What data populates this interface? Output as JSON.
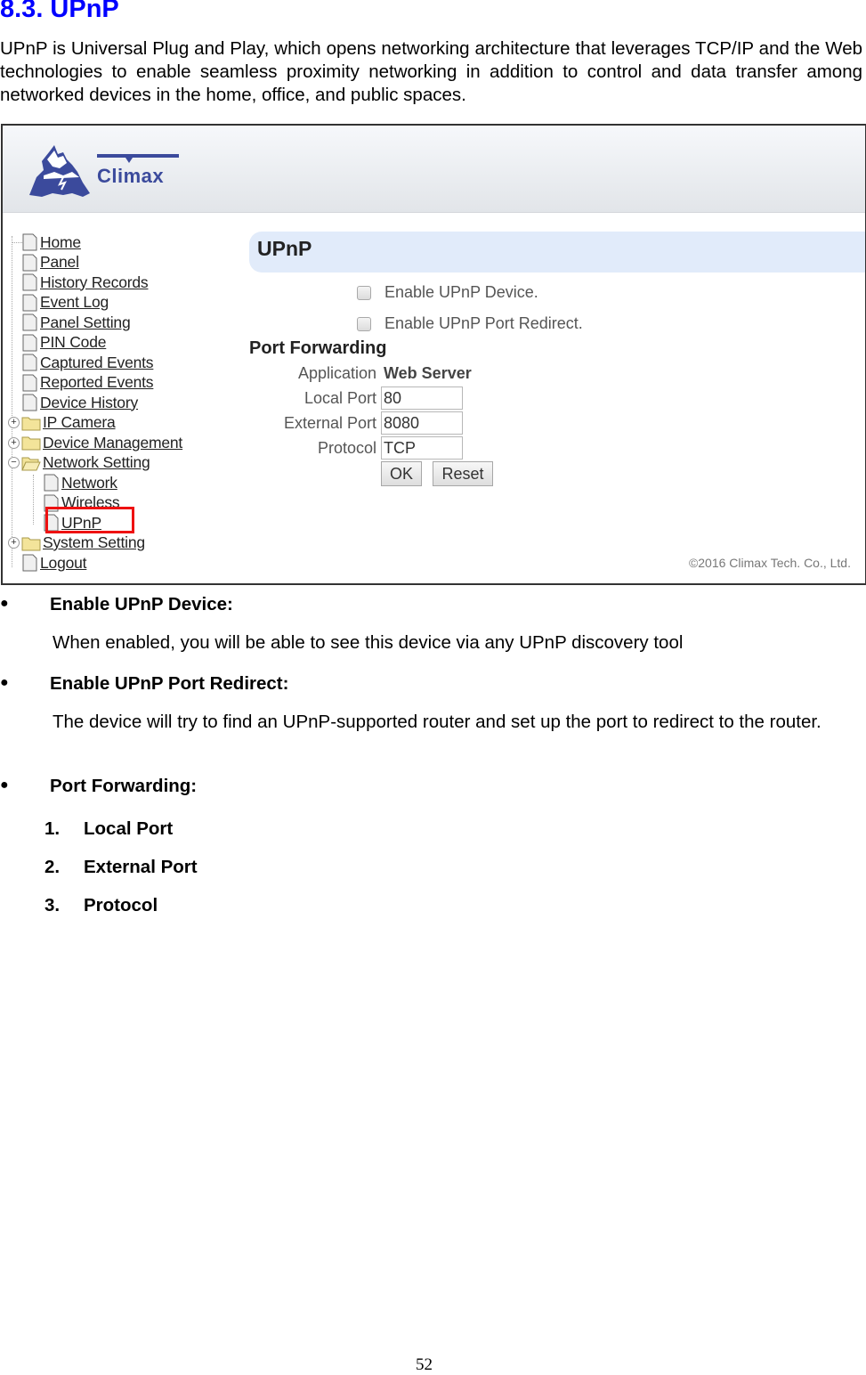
{
  "document": {
    "section_title": "8.3. UPnP",
    "intro": "UPnP is Universal Plug and Play, which opens networking architecture that leverages TCP/IP and the Web technologies to enable seamless proximity networking in addition to control and data transfer among networked devices in the home, office, and public spaces.",
    "page_number": "52"
  },
  "screenshot": {
    "brand": "Climax",
    "brand_color": "#3b4a9c",
    "highlight_color": "#ee1111",
    "nav": [
      {
        "label": "Home",
        "type": "file",
        "level": 0
      },
      {
        "label": "Panel",
        "type": "file",
        "level": 0
      },
      {
        "label": "History Records",
        "type": "file",
        "level": 0
      },
      {
        "label": "Event Log",
        "type": "file",
        "level": 0
      },
      {
        "label": "Panel Setting",
        "type": "file",
        "level": 0
      },
      {
        "label": "PIN Code",
        "type": "file",
        "level": 0
      },
      {
        "label": "Captured Events",
        "type": "file",
        "level": 0
      },
      {
        "label": "Reported Events",
        "type": "file",
        "level": 0
      },
      {
        "label": "Device History",
        "type": "file",
        "level": 0
      },
      {
        "label": "IP Camera",
        "type": "folder",
        "level": 0,
        "expanded": false
      },
      {
        "label": "Device Management",
        "type": "folder",
        "level": 0,
        "expanded": false
      },
      {
        "label": "Network Setting",
        "type": "folder",
        "level": 0,
        "expanded": true
      },
      {
        "label": "Network",
        "type": "file",
        "level": 1
      },
      {
        "label": "Wireless",
        "type": "file",
        "level": 1
      },
      {
        "label": "UPnP",
        "type": "file",
        "level": 1,
        "highlighted": true
      },
      {
        "label": "System Setting",
        "type": "folder",
        "level": 0,
        "expanded": false
      },
      {
        "label": "Logout",
        "type": "file",
        "level": 0
      }
    ],
    "page_title": "UPnP",
    "checkboxes": [
      {
        "label": "Enable UPnP Device.",
        "checked": false
      },
      {
        "label": "Enable UPnP Port Redirect.",
        "checked": false
      }
    ],
    "port_forwarding": {
      "title": "Port Forwarding",
      "application_label": "Application",
      "application_value": "Web Server",
      "local_port_label": "Local Port",
      "local_port_value": "80",
      "external_port_label": "External Port",
      "external_port_value": "8080",
      "protocol_label": "Protocol",
      "protocol_value": "TCP",
      "ok_label": "OK",
      "reset_label": "Reset"
    },
    "copyright": "©2016 Climax Tech. Co., Ltd."
  },
  "descriptions": [
    {
      "heading": "Enable UPnP Device:",
      "text": "When enabled, you will be able to see this device via any UPnP discovery tool"
    },
    {
      "heading": "Enable UPnP Port Redirect:",
      "text": "The device will try to find an UPnP-supported router and set up the port to redirect to the router."
    },
    {
      "heading": "Port Forwarding:",
      "text": ""
    }
  ],
  "port_forwarding_items": [
    {
      "number": "1.",
      "label": "Local Port"
    },
    {
      "number": "2.",
      "label": "External Port"
    },
    {
      "number": "3.",
      "label": "Protocol"
    }
  ]
}
